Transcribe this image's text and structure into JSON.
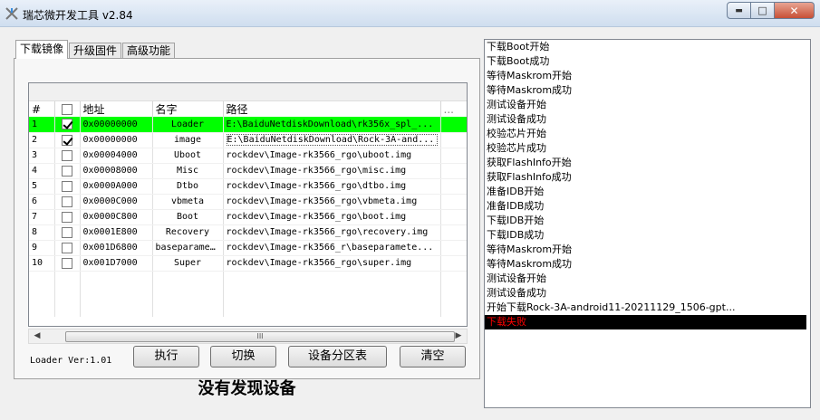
{
  "window": {
    "title": "瑞芯微开发工具 v2.84",
    "controls": {
      "minimize": "▭",
      "maximize": "□",
      "close": "✕"
    }
  },
  "tabs": [
    {
      "label": "下载镜像",
      "active": true
    },
    {
      "label": "升级固件",
      "active": false
    },
    {
      "label": "高级功能",
      "active": false
    }
  ],
  "table": {
    "headers": {
      "index": "#",
      "check": "☐",
      "address": "地址",
      "name": "名字",
      "path": "路径",
      "more": "..."
    },
    "rows": [
      {
        "index": "1",
        "checked": true,
        "address": "0x00000000",
        "name": "Loader",
        "path": "E:\\BaiduNetdiskDownload\\rk356x_spl_...",
        "highlight": true
      },
      {
        "index": "2",
        "checked": true,
        "address": "0x00000000",
        "name": "image",
        "path": "E:\\BaiduNetdiskDownload\\Rock-3A-and...",
        "highlight": false,
        "selected": true
      },
      {
        "index": "3",
        "checked": false,
        "address": "0x00004000",
        "name": "Uboot",
        "path": "rockdev\\Image-rk3566_rgo\\uboot.img"
      },
      {
        "index": "4",
        "checked": false,
        "address": "0x00008000",
        "name": "Misc",
        "path": "rockdev\\Image-rk3566_rgo\\misc.img"
      },
      {
        "index": "5",
        "checked": false,
        "address": "0x0000A000",
        "name": "Dtbo",
        "path": "rockdev\\Image-rk3566_rgo\\dtbo.img"
      },
      {
        "index": "6",
        "checked": false,
        "address": "0x0000C000",
        "name": "vbmeta",
        "path": "rockdev\\Image-rk3566_rgo\\vbmeta.img"
      },
      {
        "index": "7",
        "checked": false,
        "address": "0x0000C800",
        "name": "Boot",
        "path": "rockdev\\Image-rk3566_rgo\\boot.img"
      },
      {
        "index": "8",
        "checked": false,
        "address": "0x0001E800",
        "name": "Recovery",
        "path": "rockdev\\Image-rk3566_rgo\\recovery.img"
      },
      {
        "index": "9",
        "checked": false,
        "address": "0x001D6800",
        "name": "baseparameter",
        "path": "rockdev\\Image-rk3566_r\\baseparamete..."
      },
      {
        "index": "10",
        "checked": false,
        "address": "0x001D7000",
        "name": "Super",
        "path": "rockdev\\Image-rk3566_rgo\\super.img"
      }
    ],
    "scroll_thumb": "III"
  },
  "bottom": {
    "loader_ver": "Loader Ver:1.01",
    "buttons": {
      "run": "执行",
      "switch": "切换",
      "partition": "设备分区表",
      "clear": "清空"
    },
    "status": "没有发现设备"
  },
  "log": {
    "lines": [
      "下载Boot开始",
      "下载Boot成功",
      "等待Maskrom开始",
      "等待Maskrom成功",
      "测试设备开始",
      "测试设备成功",
      "校验芯片开始",
      "校验芯片成功",
      "获取FlashInfo开始",
      "获取FlashInfo成功",
      "准备IDB开始",
      "准备IDB成功",
      "下载IDB开始",
      "下载IDB成功",
      "等待Maskrom开始",
      "等待Maskrom成功",
      "测试设备开始",
      "测试设备成功",
      "开始下载Rock-3A-android11-20211129_1506-gpt..."
    ],
    "error_line": "下载失败"
  },
  "colors": {
    "highlight_row": "#00ff00",
    "error_bg": "#000000",
    "error_text": "#ff0000"
  }
}
